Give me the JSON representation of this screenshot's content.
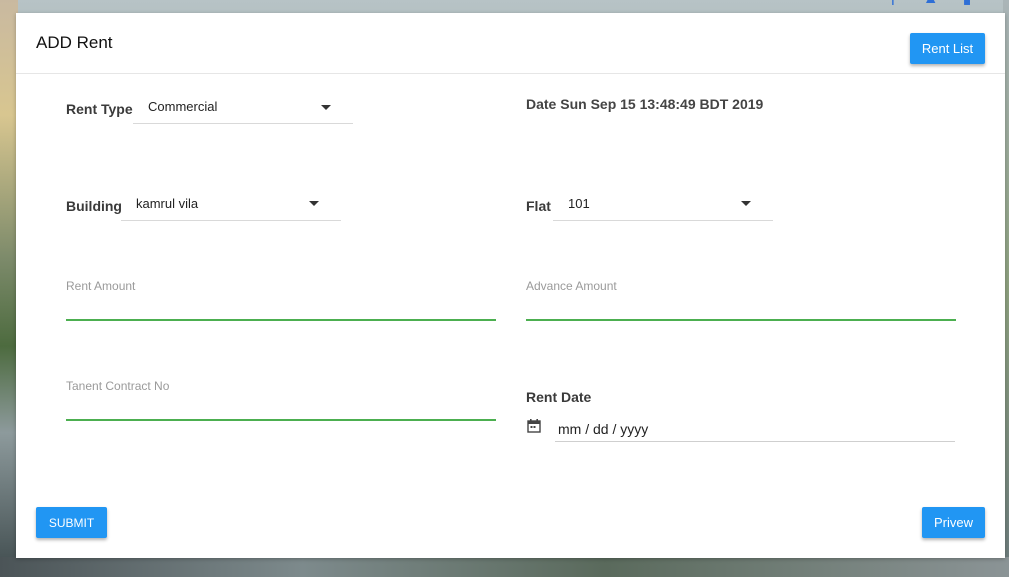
{
  "form": {
    "title": "ADD Rent",
    "rent_list_label": "Rent List",
    "submit_label": "SUBMIT",
    "preview_label": "Prive​w",
    "date_display": "Date Sun Sep 15 13:48:49 BDT 2019",
    "rent_type": {
      "label": "Rent Type",
      "value": "Commercial"
    },
    "building": {
      "label": "Building",
      "value": "kamrul vila"
    },
    "flat": {
      "label": "Flat",
      "value": "101"
    },
    "rent_amount": {
      "placeholder": "Rent Amount",
      "value": ""
    },
    "advance_amount": {
      "placeholder": "Advance Amount",
      "value": ""
    },
    "contract_no": {
      "placeholder": "Tanent Contract No",
      "value": ""
    },
    "rent_date": {
      "label": "Rent Date",
      "placeholder": "mm / dd / yyyy"
    }
  },
  "colors": {
    "primary": "#2196f3",
    "valid_line": "#4caf50"
  },
  "icons": [
    "search-icon",
    "bell-icon",
    "calendar-icon"
  ]
}
